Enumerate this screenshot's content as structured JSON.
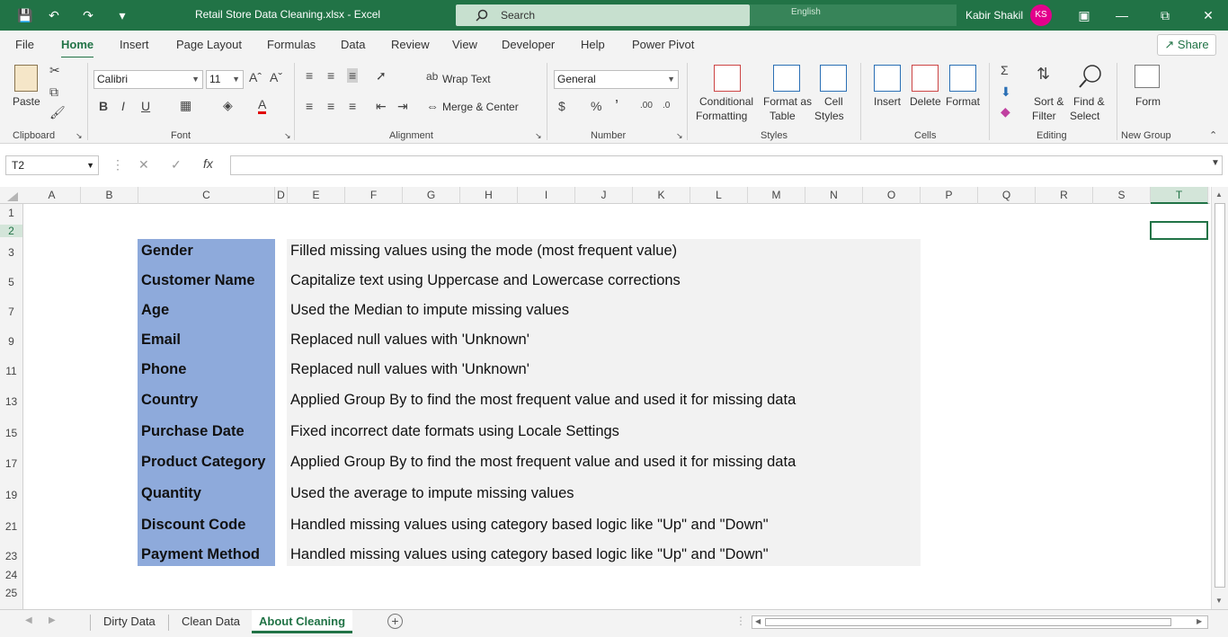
{
  "window": {
    "title": "Retail Store Data Cleaning.xlsx  -  Excel",
    "search_placeholder": "Search",
    "language": "English",
    "user_name": "Kabir Shakil",
    "user_initials": "KS"
  },
  "menu": {
    "items": [
      "File",
      "Home",
      "Insert",
      "Page Layout",
      "Formulas",
      "Data",
      "Review",
      "View",
      "Developer",
      "Help",
      "Power Pivot"
    ],
    "active": "Home",
    "share_label": "Share"
  },
  "ribbon": {
    "clipboard": {
      "paste": "Paste",
      "label": "Clipboard"
    },
    "font": {
      "name": "Calibri",
      "size": "11",
      "label": "Font"
    },
    "alignment": {
      "wrap": "Wrap Text",
      "merge": "Merge & Center",
      "label": "Alignment"
    },
    "number": {
      "format": "General",
      "label": "Number"
    },
    "styles": {
      "conditional": "Conditional",
      "conditional2": "Formatting",
      "format_as": "Format as",
      "format_as2": "Table",
      "cell": "Cell",
      "cell2": "Styles",
      "label": "Styles"
    },
    "cells": {
      "insert": "Insert",
      "delete": "Delete",
      "format": "Format",
      "label": "Cells"
    },
    "editing": {
      "sort": "Sort &",
      "sort2": "Filter",
      "find": "Find &",
      "find2": "Select",
      "label": "Editing"
    },
    "newgroup": {
      "form": "Form",
      "label": "New Group"
    }
  },
  "formula_bar": {
    "name_box": "T2",
    "formula": ""
  },
  "columns": [
    "A",
    "B",
    "C",
    "D",
    "E",
    "F",
    "G",
    "H",
    "I",
    "J",
    "K",
    "L",
    "M",
    "N",
    "O",
    "P",
    "Q",
    "R",
    "S",
    "T"
  ],
  "selected_column": "T",
  "rows": [
    "1",
    "2",
    "3",
    "5",
    "7",
    "9",
    "11",
    "13",
    "15",
    "17",
    "19",
    "21",
    "23",
    "24",
    "25"
  ],
  "cleaning": [
    {
      "field": "Gender",
      "description": "Filled missing values using the mode (most frequent value)"
    },
    {
      "field": "Customer Name",
      "description": "Capitalize text using Uppercase and Lowercase corrections"
    },
    {
      "field": "Age",
      "description": "Used the Median to impute missing values"
    },
    {
      "field": "Email",
      "description": "Replaced null values with 'Unknown'"
    },
    {
      "field": "Phone",
      "description": "Replaced null values with 'Unknown'"
    },
    {
      "field": "Country",
      "description": "Applied Group By to find the most frequent value and used it for missing data"
    },
    {
      "field": "Purchase Date",
      "description": "Fixed incorrect date formats using Locale Settings"
    },
    {
      "field": "Product Category",
      "description": "Applied Group By to find the most frequent value and used it for missing data"
    },
    {
      "field": "Quantity",
      "description": "Used the average to impute missing values"
    },
    {
      "field": "Discount Code",
      "description": "Handled missing values using category based logic like \"Up\" and \"Down\""
    },
    {
      "field": "Payment Method",
      "description": "Handled missing values using category based logic like \"Up\" and \"Down\""
    }
  ],
  "sheets": [
    "Dirty Data",
    "Clean Data",
    "About Cleaning"
  ],
  "active_sheet": "About Cleaning",
  "colors": {
    "brand": "#217346",
    "label_fill": "#8eaadb",
    "desc_fill": "#f2f2f2",
    "avatar": "#e3008c"
  }
}
